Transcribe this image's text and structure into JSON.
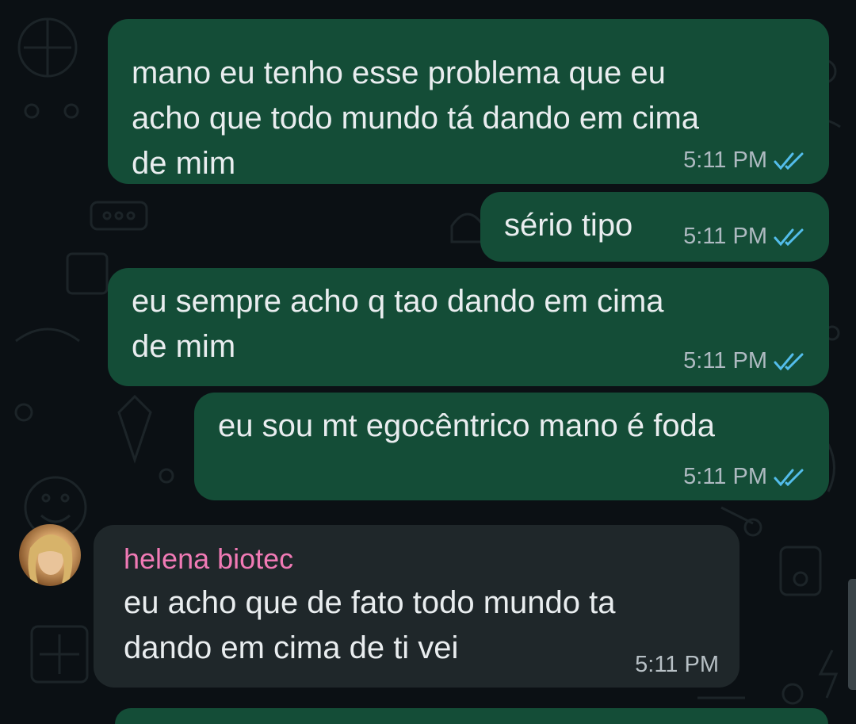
{
  "messages": [
    {
      "direction": "outgoing",
      "text": "mano eu tenho esse problema que eu\nacho que todo mundo tá dando em cima\nde mim",
      "time": "5:11 PM",
      "status": "read"
    },
    {
      "direction": "outgoing",
      "text": "sério tipo",
      "time": "5:11 PM",
      "status": "read"
    },
    {
      "direction": "outgoing",
      "text": "eu sempre acho q tao dando em cima\nde mim",
      "time": "5:11 PM",
      "status": "read"
    },
    {
      "direction": "outgoing",
      "text": "eu sou mt egocêntrico mano é foda",
      "time": "5:11 PM",
      "status": "read"
    },
    {
      "direction": "incoming",
      "sender": "helena biotec",
      "text": "eu acho que de fato todo mundo ta\ndando em cima de ti vei",
      "time": "5:11 PM"
    }
  ],
  "colors": {
    "background": "#0b1014",
    "outgoing_bubble": "#144d37",
    "incoming_bubble": "#1f272a",
    "message_text": "#e9edef",
    "timestamp": "#aebac1",
    "read_ticks": "#53bdeb",
    "sender_name": "#f07ab5"
  },
  "icons": {
    "read_receipt": "double-check-icon",
    "avatar": "contact-avatar"
  }
}
